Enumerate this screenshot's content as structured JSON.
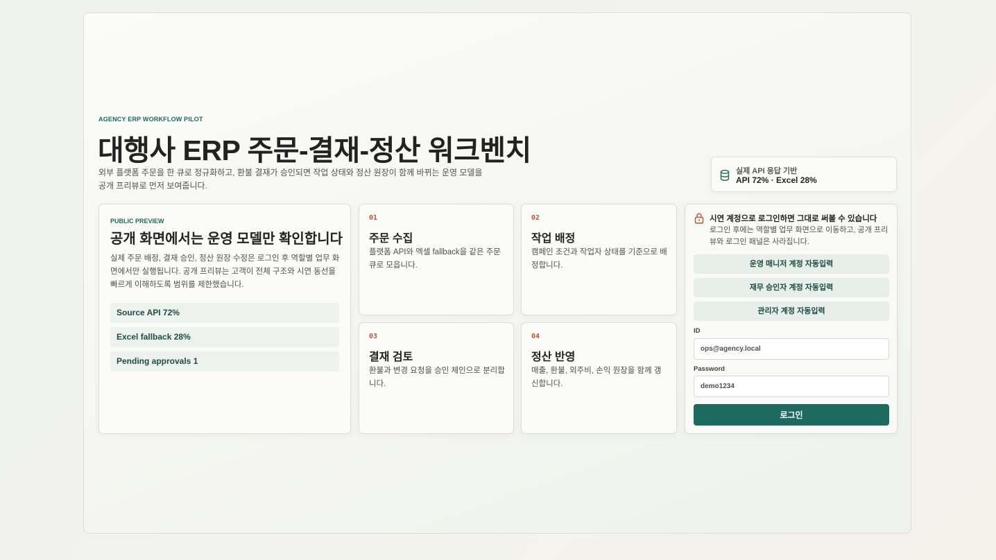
{
  "hero": {
    "eyebrow": "AGENCY ERP WORKFLOW PILOT",
    "title": "대행사 ERP 주문-결재-정산 워크벤치",
    "description": "외부 플랫폼 주문을 한 큐로 정규화하고, 환불 결재가 승인되면 작업 상태와 정산 원장이 함께 바뀌는 운영 모델을 공개 프리뷰로 먼저 보여줍니다."
  },
  "source_badge": {
    "icon": "database-icon",
    "line1": "실제 API 응답 기반",
    "line2": "API 72% · Excel 28%"
  },
  "preview": {
    "tag": "PUBLIC PREVIEW",
    "title": "공개 화면에서는 운영 모델만 확인합니다",
    "body": "실제 주문 배정, 결재 승인, 정산 원장 수정은 로그인 후 역할별 업무 화면에서만 실행됩니다. 공개 프리뷰는 고객이 전체 구조와 시연 동선을 빠르게 이해하도록 범위를 제한했습니다.",
    "pills": [
      "Source API 72%",
      "Excel fallback 28%",
      "Pending approvals 1"
    ]
  },
  "steps": [
    {
      "num": "01",
      "title": "주문 수집",
      "desc": "플랫폼 API와 엑셀 fallback을 같은 주문 큐로 모읍니다."
    },
    {
      "num": "02",
      "title": "작업 배정",
      "desc": "캠페인 조건과 작업자 상태를 기준으로 배정합니다."
    },
    {
      "num": "03",
      "title": "결재 검토",
      "desc": "환불과 변경 요청을 승인 체인으로 분리합니다."
    },
    {
      "num": "04",
      "title": "정산 반영",
      "desc": "매출, 환불, 외주비, 손익 원장을 함께 갱신합니다."
    }
  ],
  "login": {
    "icon": "lock-icon",
    "heading": "시연 계정으로 로그인하면 그대로 써볼 수 있습니다",
    "description": "로그인 후에는 역할별 업무 화면으로 이동하고, 공개 프리뷰와 로그인 패널은 사라집니다.",
    "autofill": [
      "운영 매니저 계정 자동입력",
      "재무 승인자 계정 자동입력",
      "관리자 계정 자동입력"
    ],
    "id_label": "ID",
    "id_value": "ops@agency.local",
    "password_label": "Password",
    "password_value": "demo1234",
    "submit_label": "로그인"
  },
  "colors": {
    "accent": "#1d6b60",
    "step_number": "#c0532f",
    "pill_bg": "#edf2ee"
  }
}
